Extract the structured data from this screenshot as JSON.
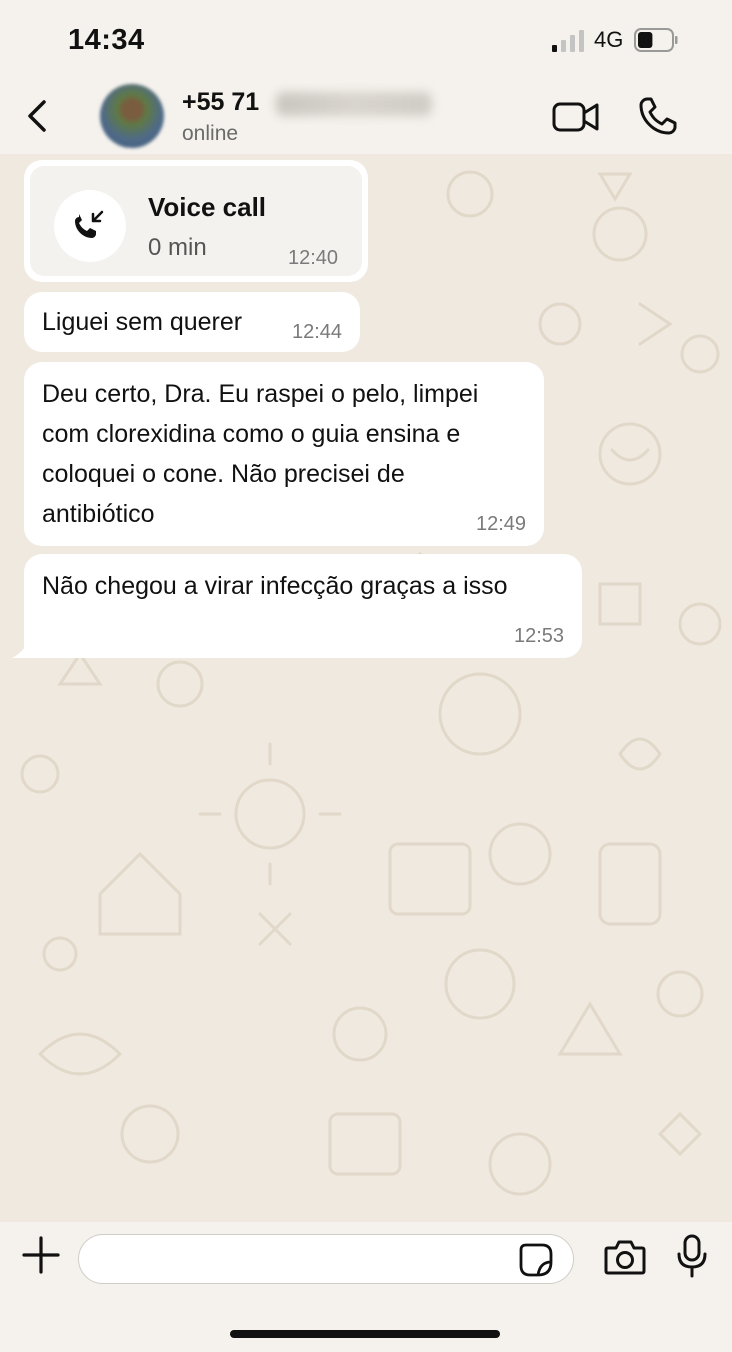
{
  "status_bar": {
    "time": "14:34",
    "network": "4G",
    "signal_icon": "signal-bars-icon",
    "battery_icon": "battery-icon",
    "battery_level": 0.45
  },
  "header": {
    "back_icon": "chevron-left-icon",
    "contact_name": "+55 71",
    "contact_status": "online",
    "video_icon": "video-camera-icon",
    "phone_icon": "phone-icon"
  },
  "messages": [
    {
      "type": "call",
      "title": "Voice call",
      "duration": "0 min",
      "time": "12:40",
      "icon": "incoming-call-icon"
    },
    {
      "type": "text",
      "text": "Liguei sem querer",
      "time": "12:44"
    },
    {
      "type": "text",
      "text": "Deu certo, Dra. Eu raspei o pelo, limpei\ncom clorexidina como o guia ensina e\ncoloquei o cone. Não precisei de\nantibiótico",
      "time": "12:49"
    },
    {
      "type": "text",
      "text": "Não chegou a virar infecção graças a isso",
      "time": "12:53"
    }
  ],
  "composer": {
    "plus_icon": "plus-icon",
    "input_value": "",
    "sticker_icon": "sticker-icon",
    "camera_icon": "camera-icon",
    "mic_icon": "microphone-icon"
  },
  "colors": {
    "background": "#f5f2ed",
    "chat_wallpaper": "#efe9df",
    "bubble": "#ffffff",
    "timestamp": "#7a7a7a"
  }
}
